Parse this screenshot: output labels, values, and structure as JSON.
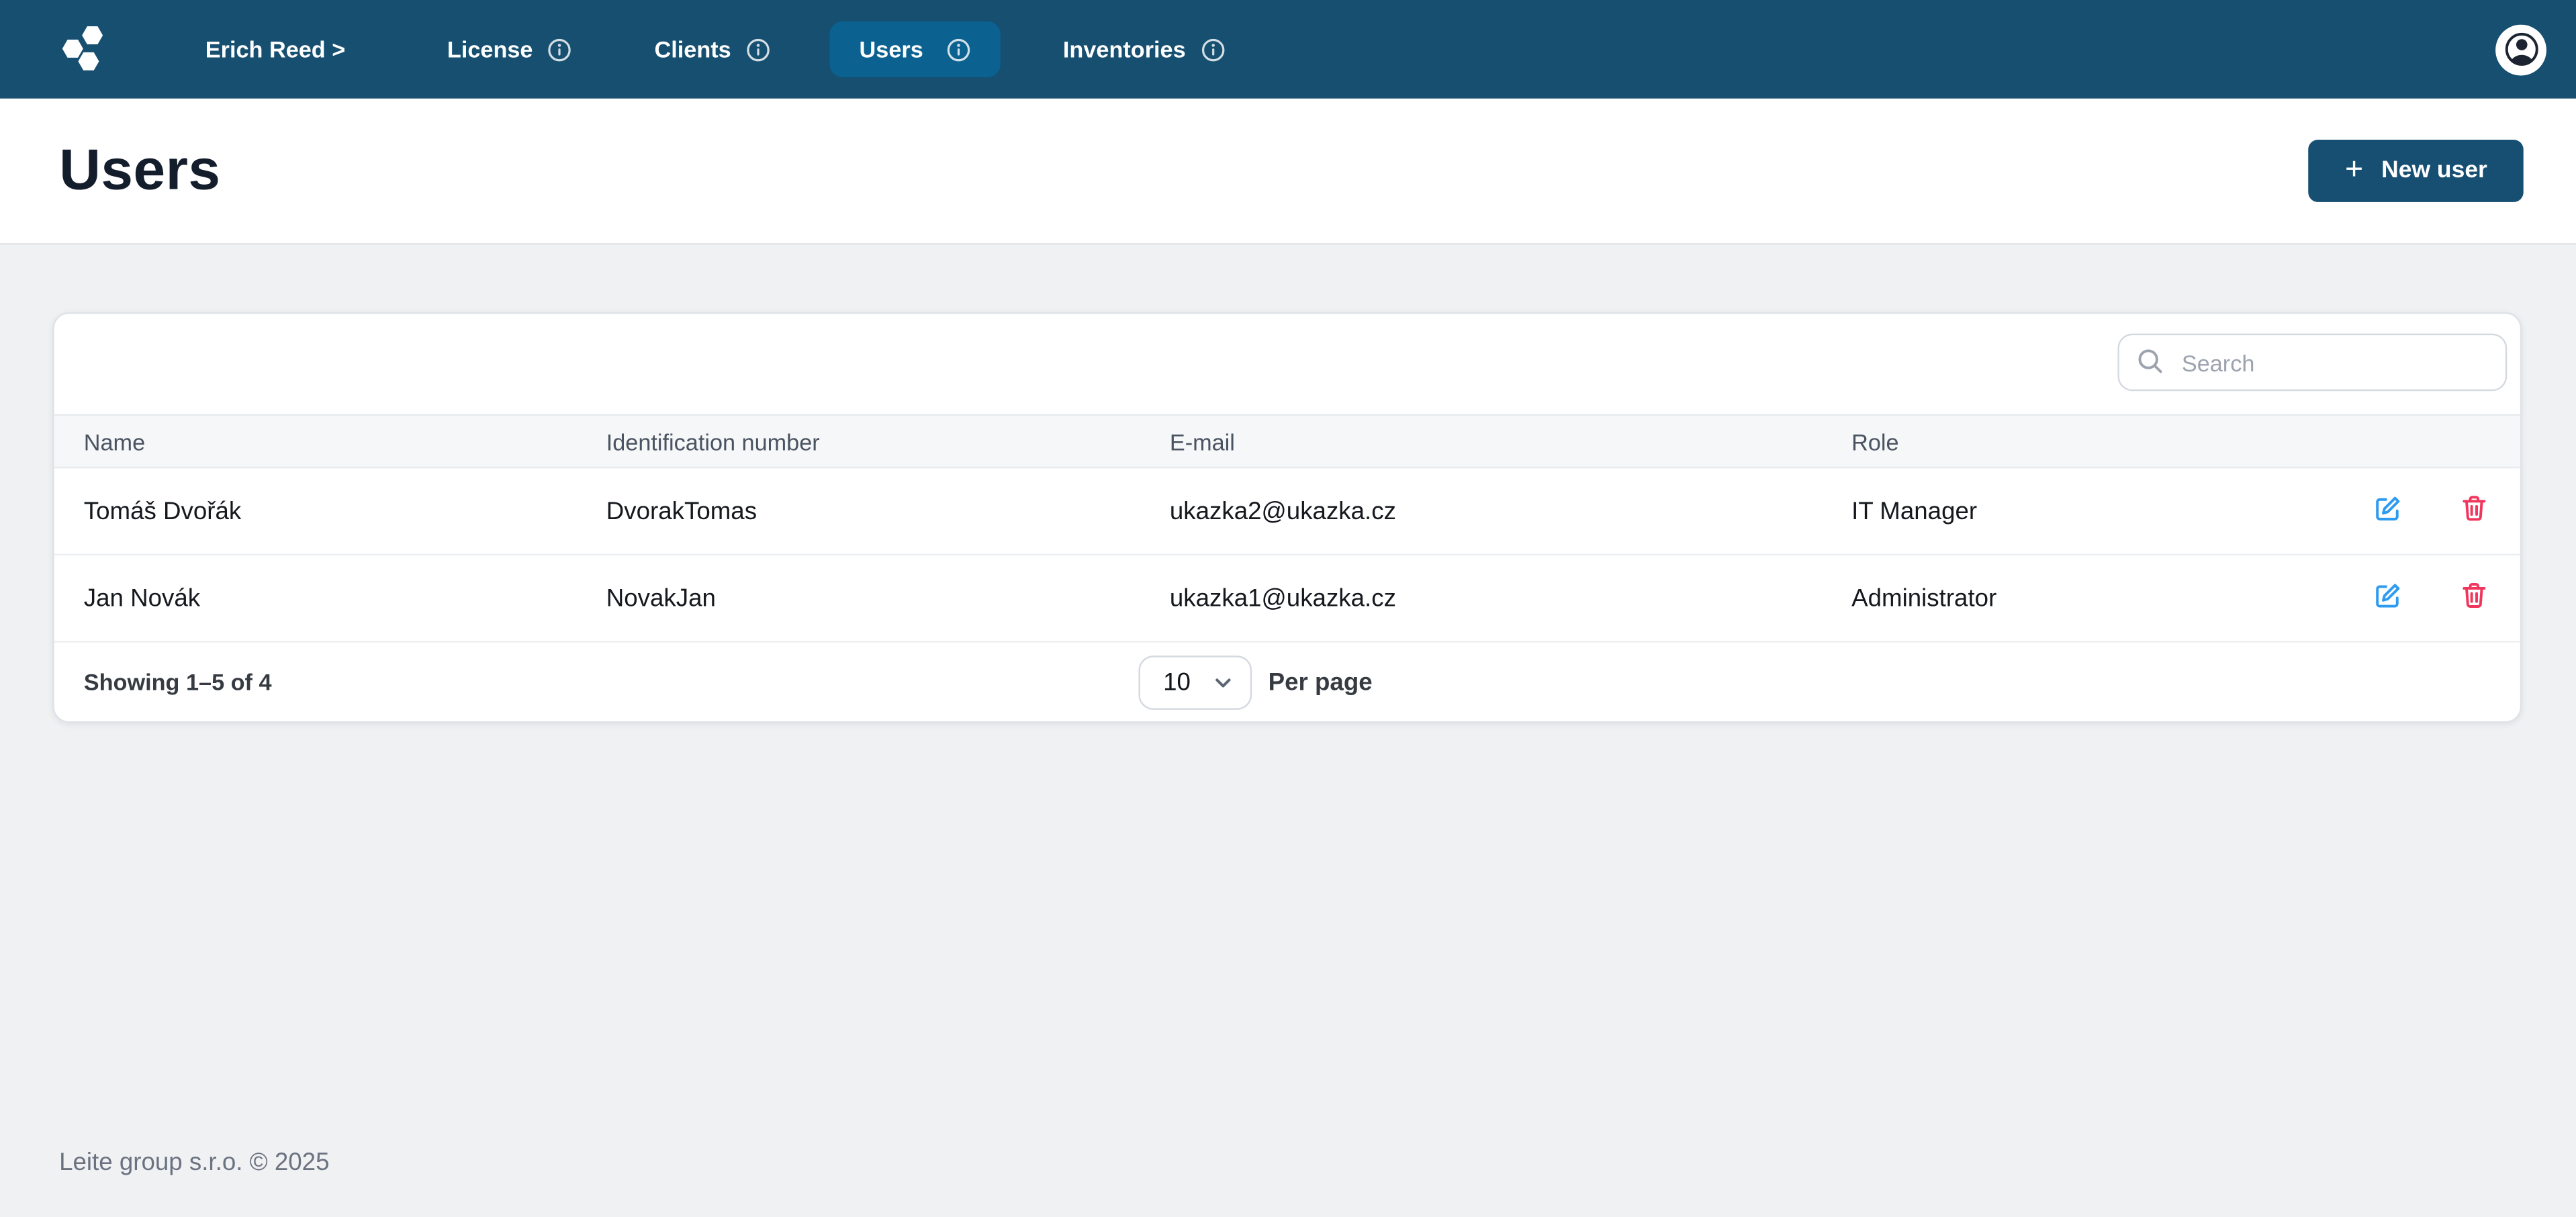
{
  "header": {
    "logo_name": "hexagon-cluster-logo",
    "user_menu_label": "Erich Reed >",
    "nav": [
      {
        "label": "License",
        "info": true,
        "active": false
      },
      {
        "label": "Clients",
        "info": true,
        "active": false
      },
      {
        "label": "Users",
        "info": true,
        "active": true
      },
      {
        "label": "Inventories",
        "info": true,
        "active": false
      }
    ]
  },
  "page": {
    "title": "Users",
    "new_user_button": {
      "plus": "+",
      "label": "New user"
    }
  },
  "table": {
    "search": {
      "placeholder": "Search"
    },
    "columns": [
      "Name",
      "Identification number",
      "E-mail",
      "Role"
    ],
    "rows": [
      {
        "name": "Tomáš Dvořák",
        "identification": "DvorakTomas",
        "email": "ukazka2@ukazka.cz",
        "role": "IT Manager"
      },
      {
        "name": "Jan Novák",
        "identification": "NovakJan",
        "email": "ukazka1@ukazka.cz",
        "role": "Administrator"
      }
    ],
    "pagination": {
      "showing": "Showing 1–5 of 4",
      "per_page_value": "10",
      "per_page_label": "Per page"
    }
  },
  "footer": {
    "copyright": "Leite group s.r.o. © 2025"
  },
  "colors": {
    "header_bg": "#164f70",
    "active_nav_bg": "#0b6190",
    "primary_button_bg": "#174f72",
    "page_bg": "#eff1f3",
    "edit_icon": "#2e9bf0",
    "delete_icon": "#f0365c",
    "title_text": "#141d2c"
  }
}
